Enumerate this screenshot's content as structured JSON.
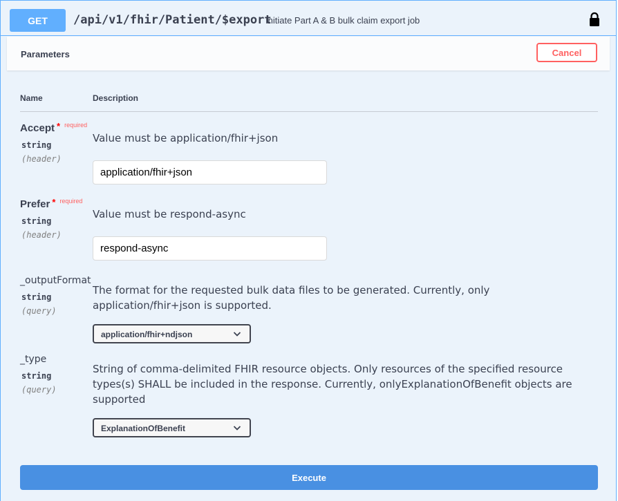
{
  "endpoint": {
    "method": "GET",
    "path": "/api/v1/fhir/Patient/$export",
    "description": "Initiate Part A & B bulk claim export job",
    "lock_icon": "lock-icon"
  },
  "parameters_section": {
    "title": "Parameters",
    "cancel_label": "Cancel",
    "col_name": "Name",
    "col_description": "Description"
  },
  "params": [
    {
      "name": "Accept",
      "required_mark": "*",
      "required_text": "required",
      "type": "string",
      "in": "(header)",
      "description": "Value must be application/fhir+json",
      "value": "application/fhir+json"
    },
    {
      "name": "Prefer",
      "required_mark": "*",
      "required_text": "required",
      "type": "string",
      "in": "(header)",
      "description": "Value must be respond-async",
      "value": "respond-async"
    },
    {
      "name": "_outputFormat",
      "type": "string",
      "in": "(query)",
      "description": "The format for the requested bulk data files to be generated. Currently, only application/fhir+json is supported.",
      "selected": "application/fhir+ndjson"
    },
    {
      "name": "_type",
      "type": "string",
      "in": "(query)",
      "description": "String of comma-delimited FHIR resource objects. Only resources of the specified resource types(s) SHALL be included in the response. Currently, onlyExplanationOfBenefit objects are supported",
      "selected": "ExplanationOfBenefit"
    }
  ],
  "execute_label": "Execute",
  "colors": {
    "get_method": "#61affe",
    "block_bg": "#ebf3fb",
    "cancel": "#ff6060",
    "execute": "#4990e2"
  }
}
